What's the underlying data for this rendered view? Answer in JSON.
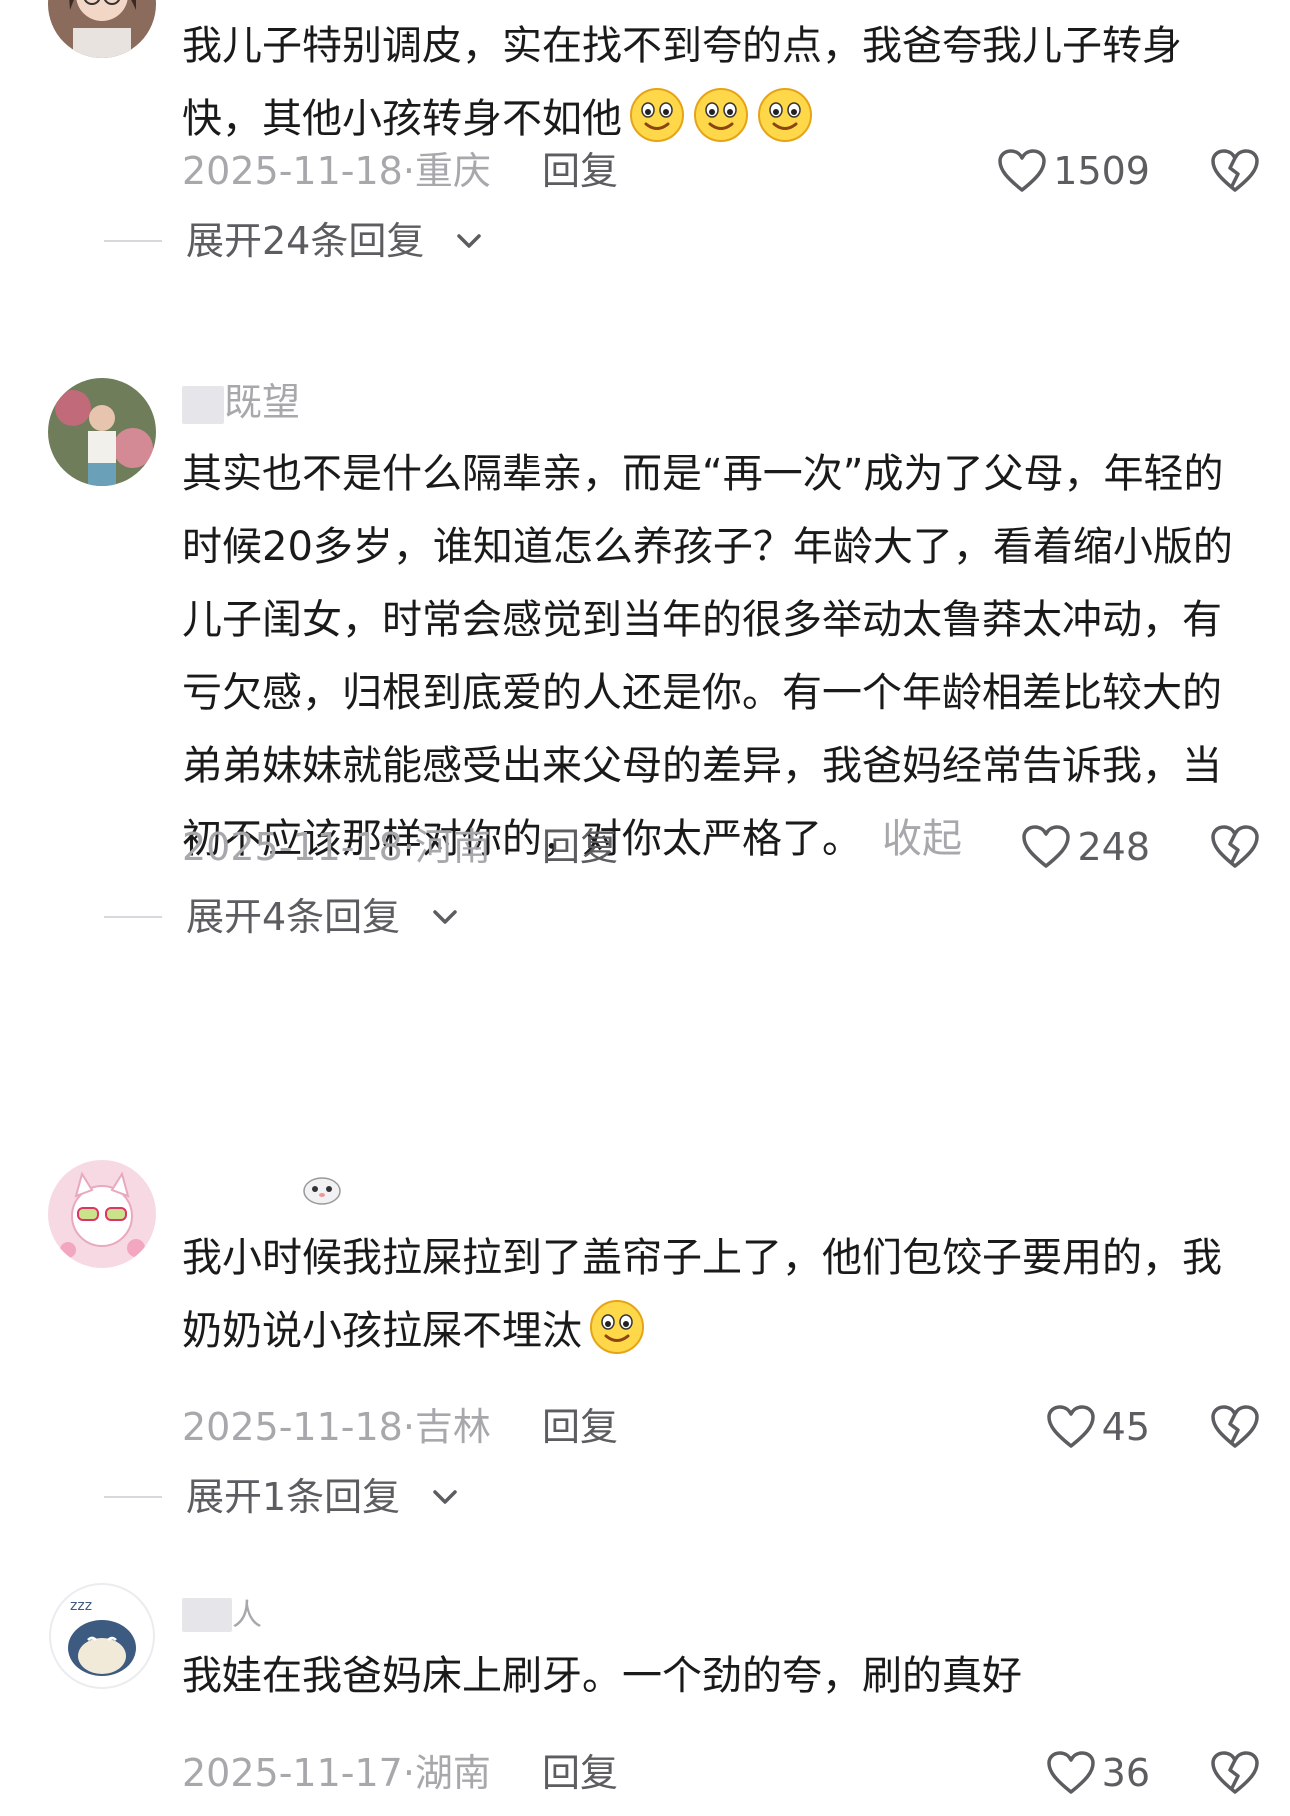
{
  "comments": [
    {
      "username": "",
      "text": "我儿子特别调皮，实在找不到夸的点，我爸夸我儿子转身快，其他小孩转身不如他",
      "date": "2025-11-18·重庆",
      "reply_label": "回复",
      "likes": "1509",
      "expand_label": "展开24条回复",
      "emoji_count": 3
    },
    {
      "username": "既望",
      "text": "其实也不是什么隔辈亲，而是“再一次”成为了父母，年轻的时候20多岁，谁知道怎么养孩子？年龄大了，看着缩小版的儿子闺女，时常会感觉到当年的很多举动太鲁莽太冲动，有亏欠感，归根到底爱的人还是你。有一个年龄相差比较大的弟弟妹妹就能感受出来父母的差异，我爸妈经常告诉我，当初不应该那样对你的，对你太严格了。",
      "collapse_label": "收起",
      "date": "2025-11-18·河南",
      "reply_label": "回复",
      "likes": "248",
      "expand_label": "展开4条回复"
    },
    {
      "username": "",
      "text": "我小时候我拉屎拉到了盖帘子上了，他们包饺子要用的，我奶奶说小孩拉屎不埋汰",
      "date": "2025-11-18·吉林",
      "reply_label": "回复",
      "likes": "45",
      "expand_label": "展开1条回复",
      "emoji_count": 1
    },
    {
      "username": "人",
      "text": "我娃在我爸妈床上刷牙。一个劲的夸，刷的真好",
      "date": "2025-11-17·湖南",
      "reply_label": "回复",
      "likes": "36"
    }
  ],
  "colors": {
    "text": "#1a1a1a",
    "secondary": "#a8a8ac",
    "action": "#5c5c61"
  },
  "icons": [
    "heart-icon",
    "broken-heart-icon",
    "chevron-down-icon",
    "smile-emoji"
  ]
}
